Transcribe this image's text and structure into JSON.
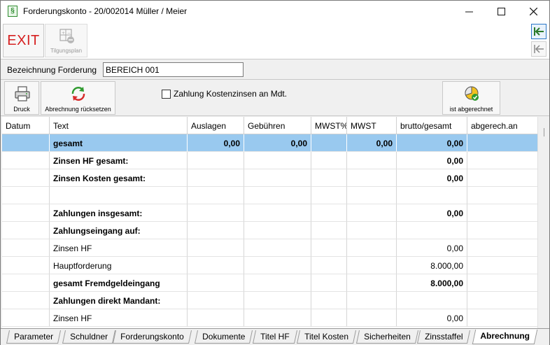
{
  "window": {
    "title": "Forderungskonto - 20/002014  Müller / Meier",
    "app_icon_glyph": "§",
    "controls": {
      "minimize": "—",
      "maximize": "☐",
      "close": "✕"
    }
  },
  "toolbar1": {
    "exit_label": "EXIT",
    "tilgungsplan_label": "Tilgungsplan"
  },
  "bezeichnung": {
    "label": "Bezeichnung Forderung",
    "value": "BEREICH 001"
  },
  "toolbar2": {
    "druck_label": "Druck",
    "reset_label": "Abrechnung rücksetzen",
    "checkbox_label": "Zahlung Kostenzinsen an Mdt.",
    "checkbox_checked": false,
    "abgerechnet_label": "ist abgerechnet"
  },
  "grid": {
    "headers": [
      "Datum",
      "Text",
      "Auslagen",
      "Gebühren",
      "MWST%",
      "MWST",
      "brutto/gesamt",
      "abgerech.an"
    ],
    "rows": [
      [
        "",
        "gesamt",
        "0,00",
        "0,00",
        "",
        "0,00",
        "0,00",
        ""
      ],
      [
        "",
        "Zinsen HF gesamt:",
        "",
        "",
        "",
        "",
        "0,00",
        ""
      ],
      [
        "",
        "Zinsen Kosten gesamt:",
        "",
        "",
        "",
        "",
        "0,00",
        ""
      ],
      [
        "",
        "",
        "",
        "",
        "",
        "",
        "",
        ""
      ],
      [
        "",
        "Zahlungen insgesamt:",
        "",
        "",
        "",
        "",
        "0,00",
        ""
      ],
      [
        "",
        "Zahlungseingang auf:",
        "",
        "",
        "",
        "",
        "",
        ""
      ],
      [
        "",
        "Zinsen HF",
        "",
        "",
        "",
        "",
        "0,00",
        ""
      ],
      [
        "",
        "Hauptforderung",
        "",
        "",
        "",
        "",
        "8.000,00",
        ""
      ],
      [
        "",
        "gesamt Fremdgeldeingang",
        "",
        "",
        "",
        "",
        "8.000,00",
        ""
      ],
      [
        "",
        "Zahlungen direkt Mandant:",
        "",
        "",
        "",
        "",
        "",
        ""
      ],
      [
        "",
        "Zinsen HF",
        "",
        "",
        "",
        "",
        "0,00",
        ""
      ]
    ]
  },
  "tabs": [
    "Parameter",
    "Schuldner",
    "Forderungskonto",
    "Dokumente",
    "Titel HF",
    "Titel Kosten",
    "Sicherheiten",
    "Zinsstaffel",
    "Abrechnung"
  ],
  "active_tab": "Abrechnung",
  "colors": {
    "selected_row": "#99c9ef",
    "exit_text": "#d62020",
    "nav_active": "#2a77c9"
  }
}
